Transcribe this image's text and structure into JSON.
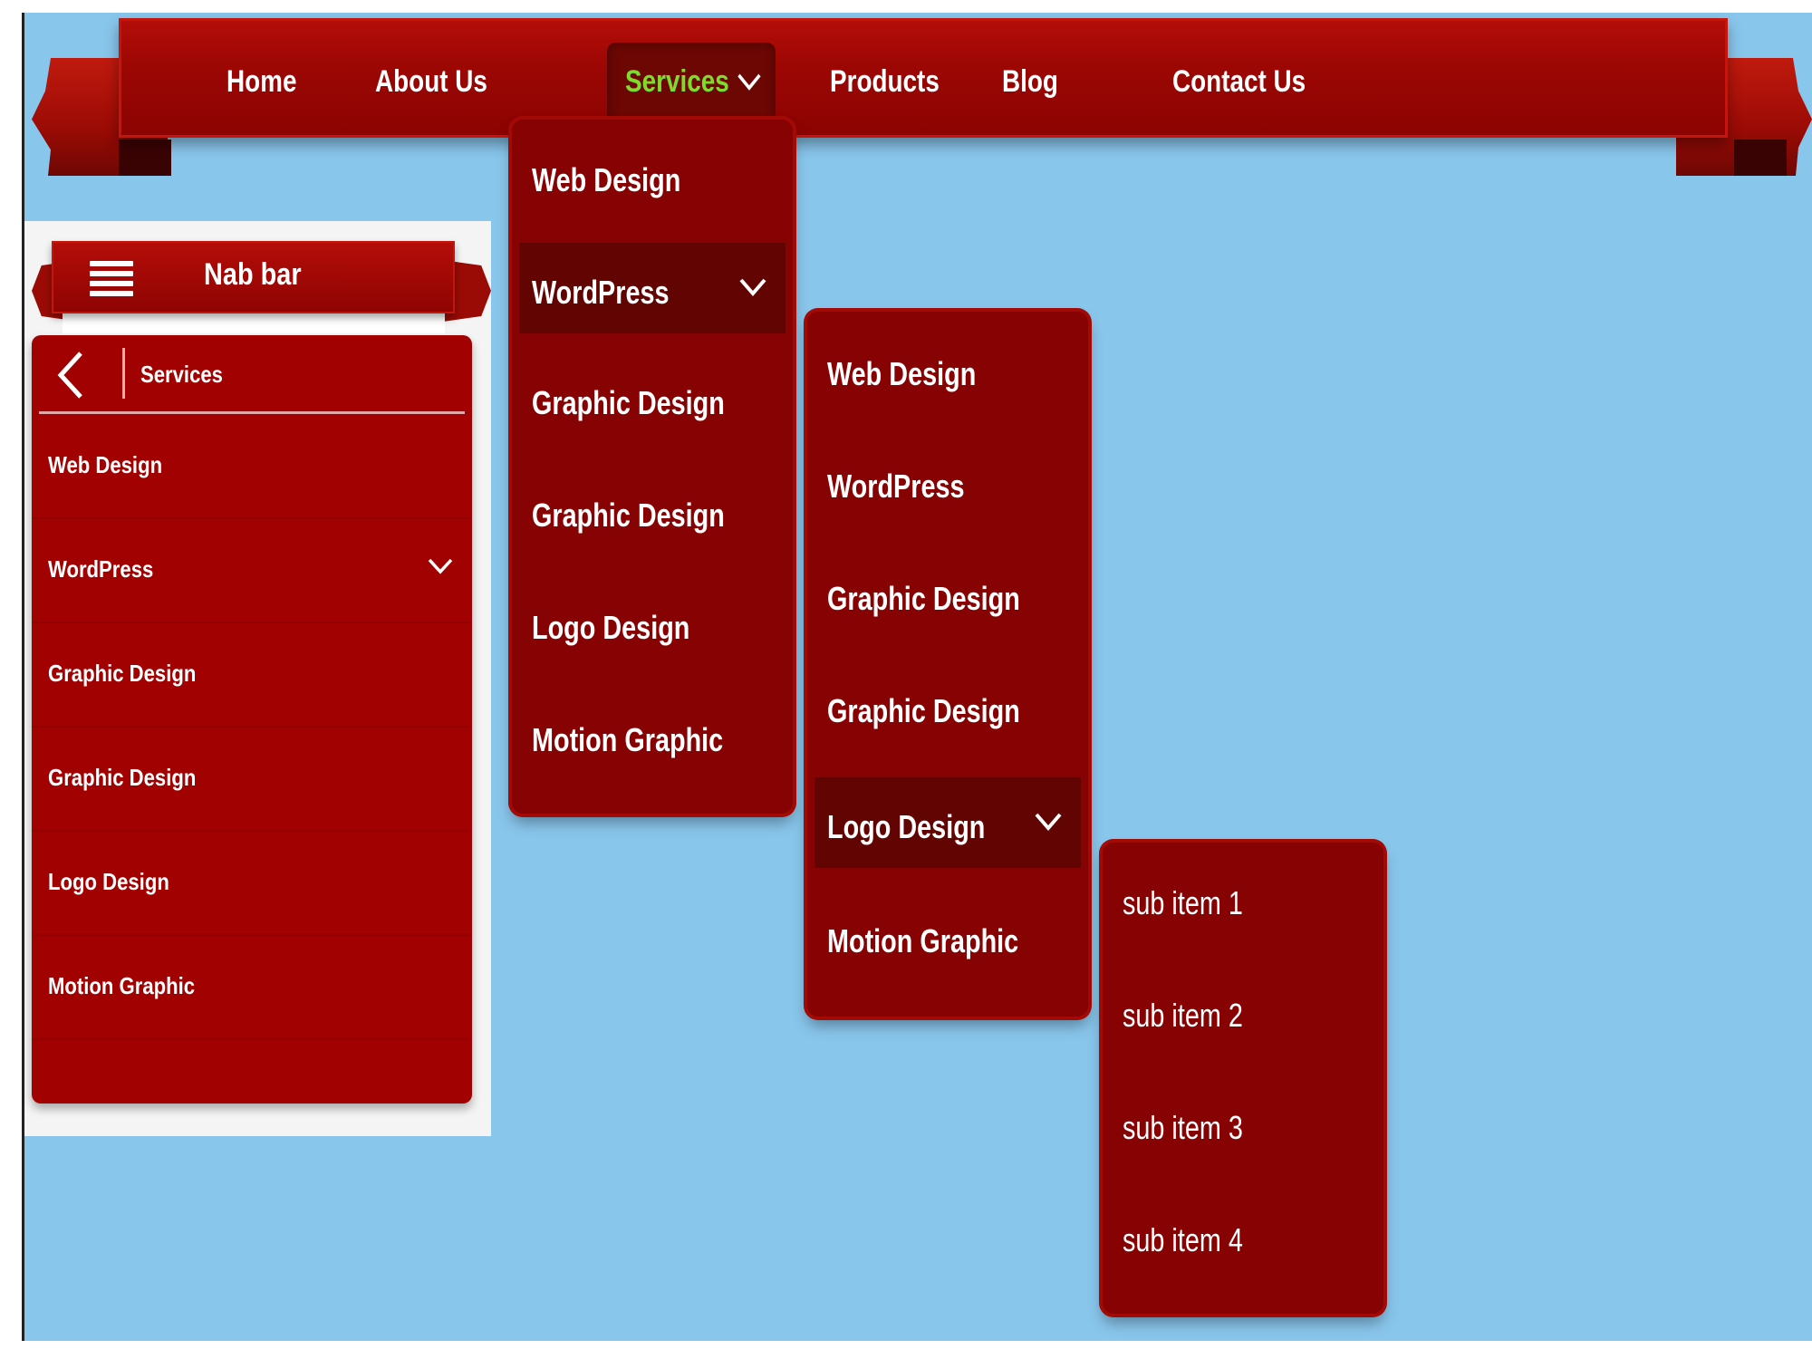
{
  "top_nav": {
    "items": [
      {
        "label": "Home"
      },
      {
        "label": "About Us"
      },
      {
        "label": "Services",
        "active": true,
        "icon": "chevron-down-icon"
      },
      {
        "label": "Products"
      },
      {
        "label": "Blog"
      },
      {
        "label": "Contact Us"
      }
    ]
  },
  "services_menu": {
    "items": [
      {
        "label": "Web Design"
      },
      {
        "label": "WordPress",
        "expanded": true,
        "icon": "chevron-down-icon"
      },
      {
        "label": "Graphic Design"
      },
      {
        "label": "Graphic Design"
      },
      {
        "label": "Logo Design"
      },
      {
        "label": "Motion Graphic"
      }
    ]
  },
  "wordpress_submenu": {
    "items": [
      {
        "label": "Web Design"
      },
      {
        "label": "WordPress"
      },
      {
        "label": "Graphic Design"
      },
      {
        "label": "Graphic Design"
      },
      {
        "label": "Logo Design",
        "expanded": true,
        "icon": "chevron-down-icon"
      },
      {
        "label": "Motion Graphic"
      }
    ]
  },
  "logo_submenu": {
    "items": [
      {
        "label": "sub item 1"
      },
      {
        "label": "sub item 2"
      },
      {
        "label": "sub item 3"
      },
      {
        "label": "sub item 4"
      }
    ]
  },
  "mobile": {
    "title": "Nab bar",
    "menu_icon": "hamburger-icon",
    "panel": {
      "title": "Services",
      "back_icon": "chevron-left-icon",
      "items": [
        {
          "label": "Web Design"
        },
        {
          "label": "WordPress",
          "icon": "chevron-down-icon"
        },
        {
          "label": "Graphic Design"
        },
        {
          "label": "Graphic Design"
        },
        {
          "label": "Logo Design"
        },
        {
          "label": "Motion Graphic"
        }
      ]
    }
  },
  "colors": {
    "background": "#89c6ec",
    "ribbon_red": "#9c0704",
    "panel_red": "#870202",
    "highlight_red": "#620402",
    "active_text": "#7ddc2c"
  }
}
